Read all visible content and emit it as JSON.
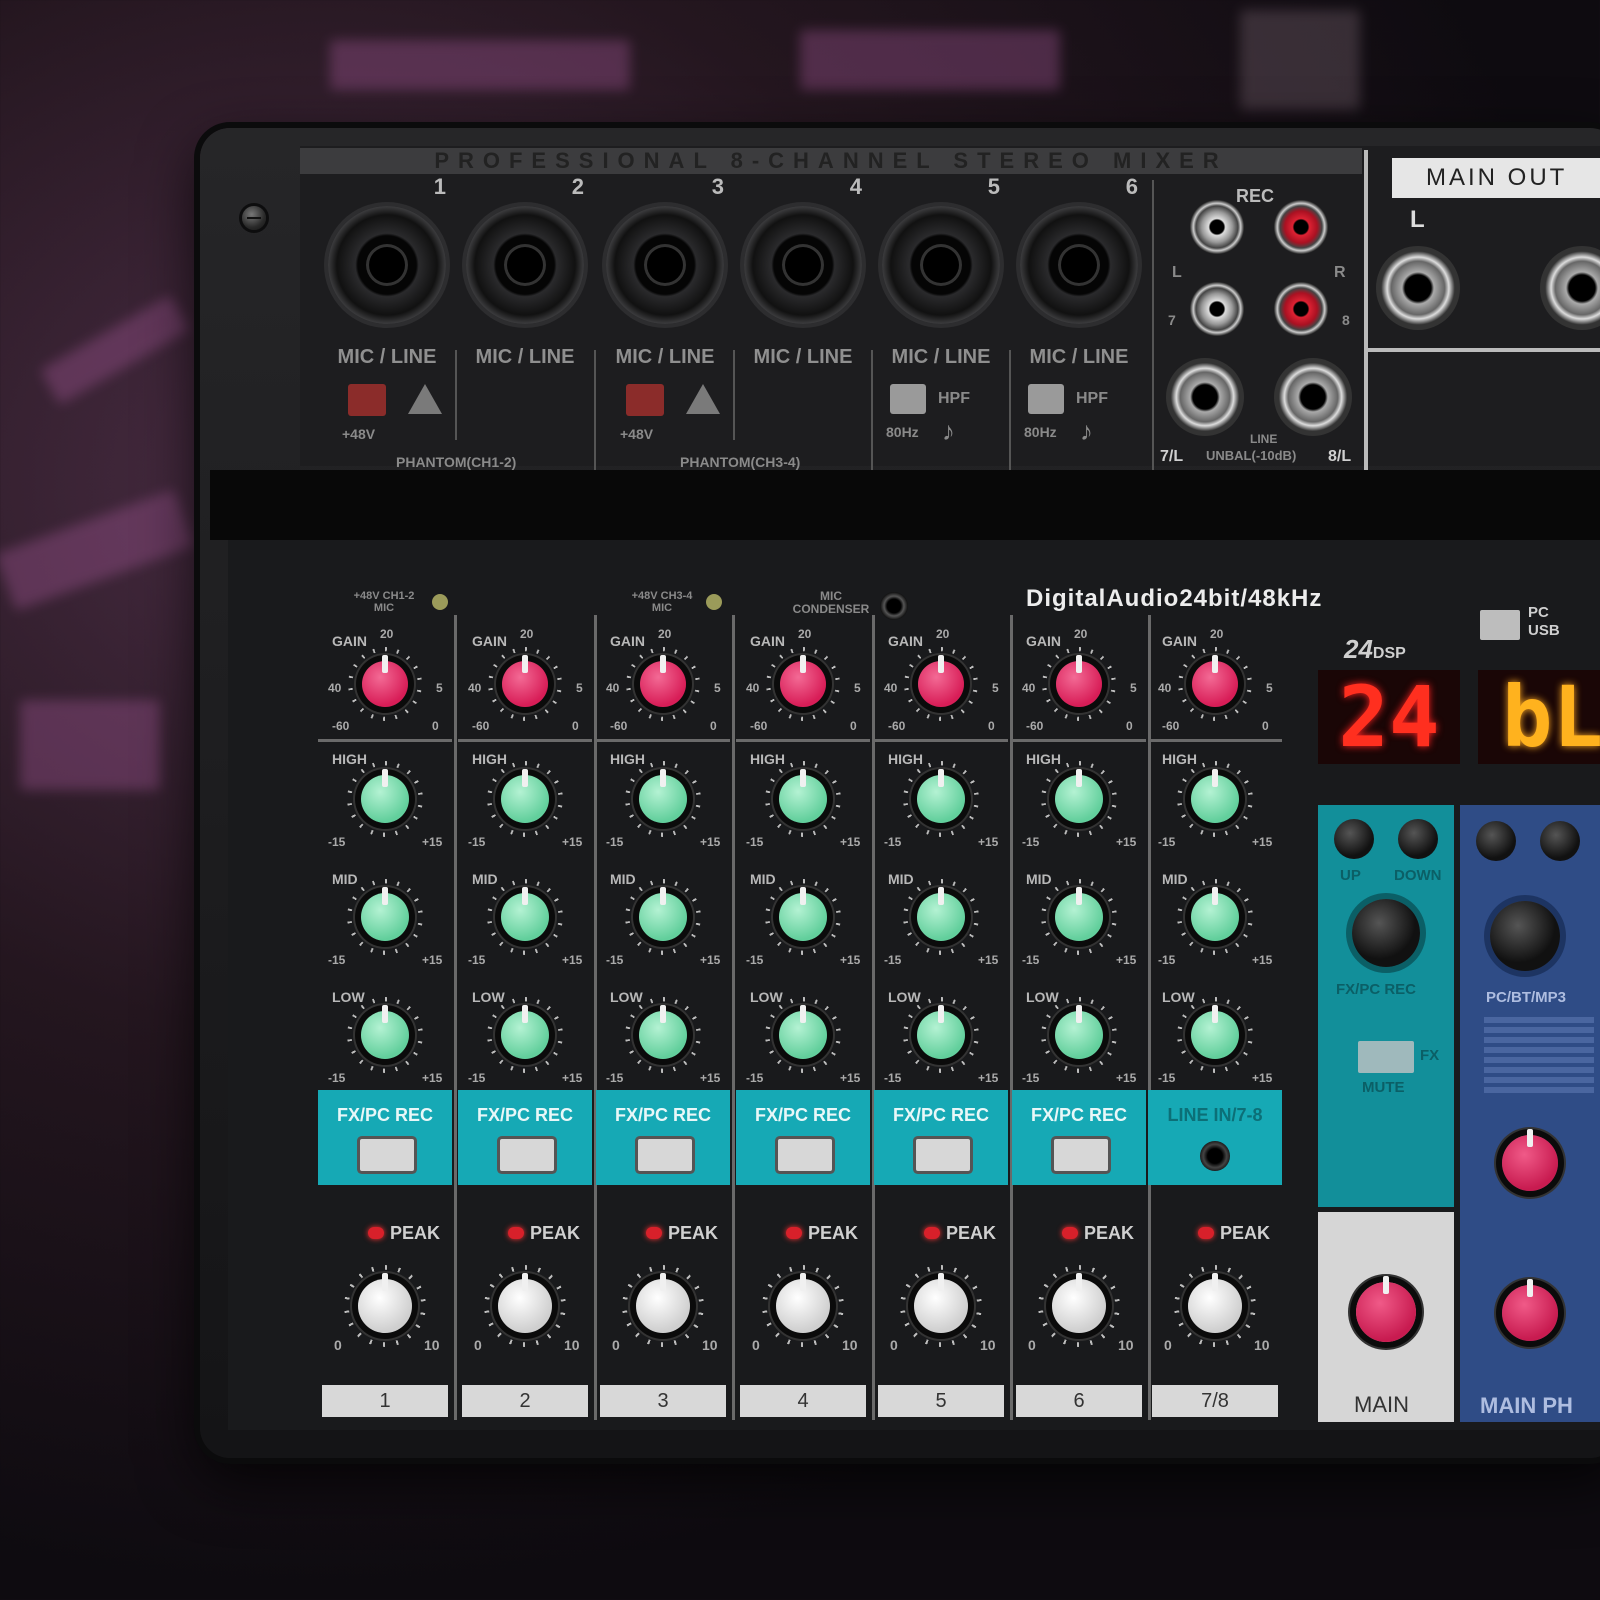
{
  "top_panel": {
    "title": "PROFESSIONAL 8-CHANNEL STEREO MIXER",
    "xlr_channels": [
      {
        "number": "1",
        "label": "MIC / LINE"
      },
      {
        "number": "2",
        "label": "MIC / LINE"
      },
      {
        "number": "3",
        "label": "MIC / LINE"
      },
      {
        "number": "4",
        "label": "MIC / LINE"
      },
      {
        "number": "5",
        "label": "MIC / LINE"
      },
      {
        "number": "6",
        "label": "MIC / LINE"
      }
    ],
    "phantom_1": {
      "voltage": "+48V",
      "label": "PHANTOM(CH1-2)"
    },
    "phantom_2": {
      "voltage": "+48V",
      "label": "PHANTOM(CH3-4)"
    },
    "hpf": {
      "label": "HPF",
      "freq": "80Hz"
    },
    "rec_label": "REC",
    "rca_l": "L",
    "rca_r": "R",
    "rca_7": "7",
    "rca_8": "8",
    "jack_7l": "7/L",
    "jack_line": "LINE",
    "jack_unbal": "UNBAL(-10dB)",
    "jack_8l": "8/L",
    "main_out": "MAIN OUT",
    "main_out_l": "L"
  },
  "lower_panel": {
    "digital_audio": "DigitalAudio24bit/48kHz",
    "dsp": "24",
    "dsp_suffix": "DSP",
    "pc_label": "PC",
    "usb_label": "USB",
    "display_left": "24",
    "display_right": "bL",
    "phantom_led_1": "+48V CH1-2 MIC",
    "phantom_led_2": "+48V CH3-4 MIC",
    "mic_condenser": "MIC CONDENSER",
    "channels": [
      {
        "gain": "GAIN",
        "high": "HIGH",
        "mid": "MID",
        "low": "LOW",
        "fx": "FX/PC REC",
        "peak": "PEAK",
        "name": "1"
      },
      {
        "gain": "GAIN",
        "high": "HIGH",
        "mid": "MID",
        "low": "LOW",
        "fx": "FX/PC REC",
        "peak": "PEAK",
        "name": "2"
      },
      {
        "gain": "GAIN",
        "high": "HIGH",
        "mid": "MID",
        "low": "LOW",
        "fx": "FX/PC REC",
        "peak": "PEAK",
        "name": "3"
      },
      {
        "gain": "GAIN",
        "high": "HIGH",
        "mid": "MID",
        "low": "LOW",
        "fx": "FX/PC REC",
        "peak": "PEAK",
        "name": "4"
      },
      {
        "gain": "GAIN",
        "high": "HIGH",
        "mid": "MID",
        "low": "LOW",
        "fx": "FX/PC REC",
        "peak": "PEAK",
        "name": "5"
      },
      {
        "gain": "GAIN",
        "high": "HIGH",
        "mid": "MID",
        "low": "LOW",
        "fx": "FX/PC REC",
        "peak": "PEAK",
        "name": "6"
      },
      {
        "gain": "GAIN",
        "high": "HIGH",
        "mid": "MID",
        "low": "LOW",
        "fx": "LINE IN/7-8",
        "peak": "PEAK",
        "name": "7/8"
      }
    ],
    "gain_range": {
      "min": "-60",
      "mid_left": "40",
      "top": "20",
      "right": "5",
      "max": "0"
    },
    "eq_range": {
      "min": "-15",
      "max": "+15"
    },
    "vol_range": {
      "min": "0",
      "max": "10"
    },
    "fx_section": {
      "up": "UP",
      "down": "DOWN",
      "label": "FX/PC REC",
      "mute": "MUTE",
      "fx": "FX"
    },
    "main_label": "MAIN",
    "player_section": {
      "label": "PC/BT/MP3",
      "main_ph": "MAIN PH"
    },
    "colors": {
      "gain_knob": "#e0245c",
      "eq_knob": "#7fe0b0",
      "fx_band": "#16a9b5",
      "blue_panel": "#2f4c86"
    }
  }
}
